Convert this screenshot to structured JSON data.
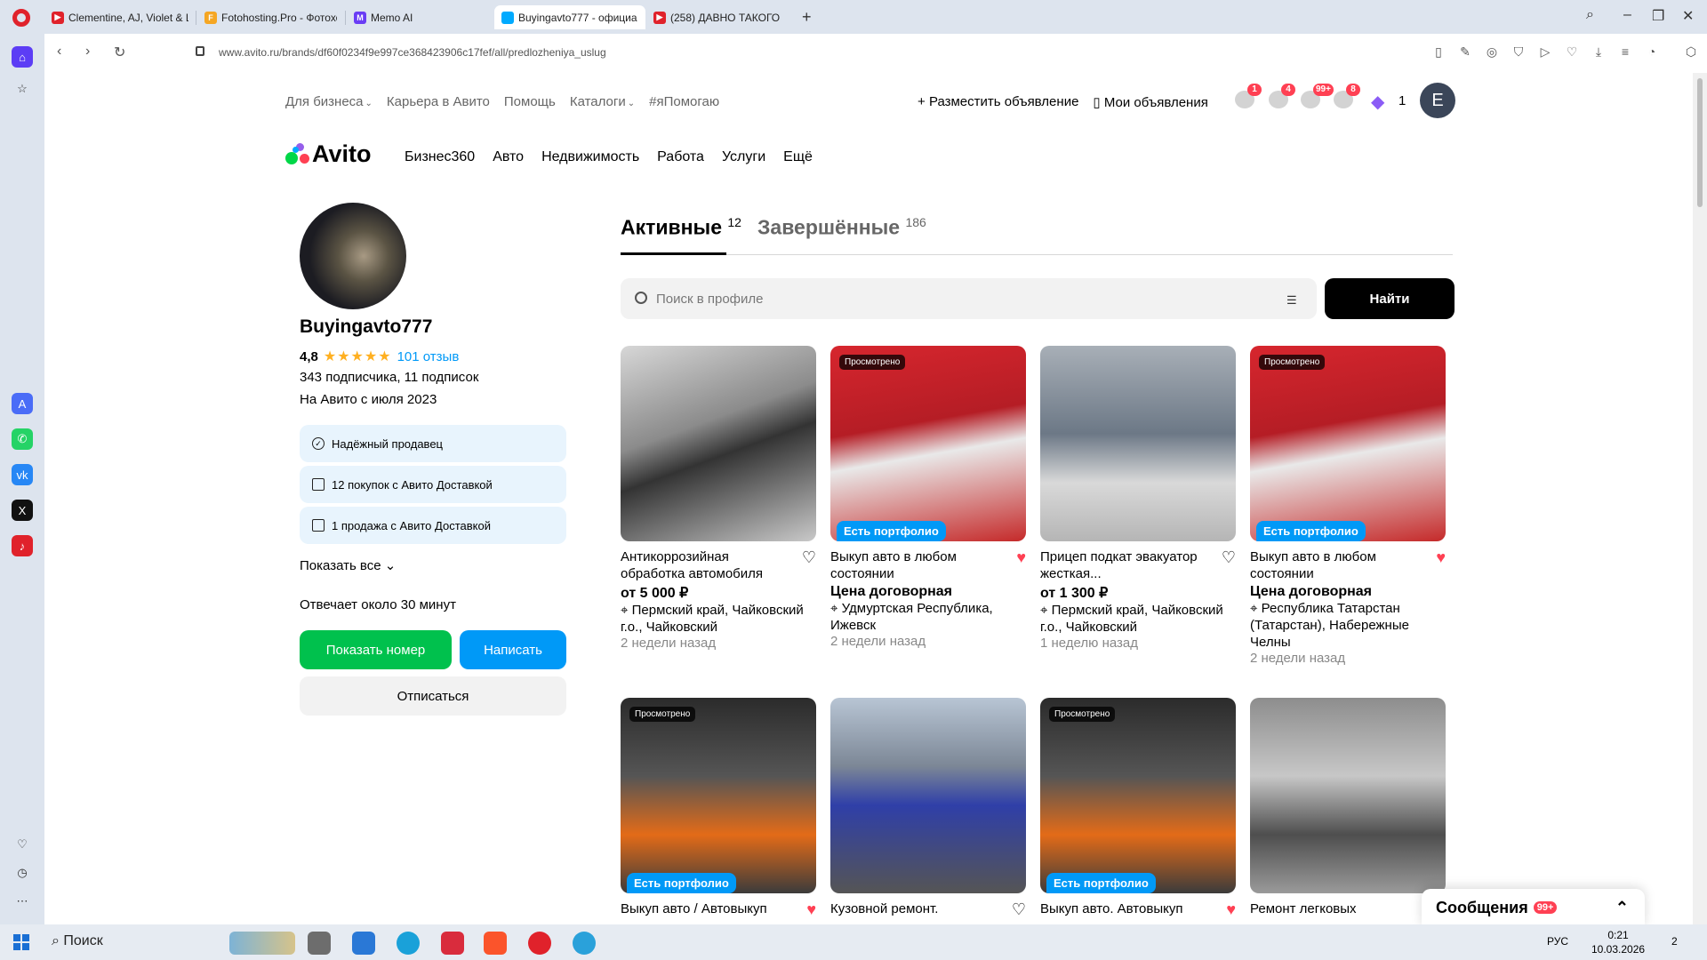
{
  "browser": {
    "tabs": [
      {
        "label": "Clementine, AJ, Violet & L",
        "color": "#e0222b"
      },
      {
        "label": "Fotohosting.Pro - Фотохо",
        "color": "#f5a623"
      },
      {
        "label": "Memo AI",
        "color": "#6a3df5"
      },
      {
        "label": "Buyingavto777 - официа",
        "color": "#00aaff"
      },
      {
        "label": "(258) ДАВНО ТАКОГО",
        "color": "#e0222b"
      }
    ],
    "url": "www.avito.ru/brands/df60f0234f9e997ce368423906c17fef/all/predlozheniya_uslug"
  },
  "header": {
    "topnav": [
      "Для бизнеса",
      "Карьера в Авито",
      "Помощь",
      "Каталоги",
      "#яПомогаю"
    ],
    "post_ad": "Разместить объявление",
    "my_ads": "Мои объявления",
    "badges": {
      "favorites": "1",
      "notifications": "4",
      "messages": "99+",
      "cart": "8"
    },
    "coins": "1",
    "user_initial": "E",
    "logo": "Avito",
    "mainnav": [
      "Бизнес360",
      "Авто",
      "Недвижимость",
      "Работа",
      "Услуги",
      "Ещё"
    ]
  },
  "profile": {
    "name": "Buyingavto777",
    "rating": "4,8",
    "reviews": "101 отзыв",
    "followers": "343 подписчика, 11 подписок",
    "since": "На Авито с июля 2023",
    "features": [
      "Надёжный продавец",
      "12 покупок с Авито Доставкой",
      "1 продажа с Авито Доставкой"
    ],
    "show_all": "Показать все",
    "response": "Отвечает около 30 минут",
    "show_phone": "Показать номер",
    "write": "Написать",
    "unsubscribe": "Отписаться"
  },
  "listing": {
    "tab_active": "Активные",
    "tab_active_count": "12",
    "tab_done": "Завершённые",
    "tab_done_count": "186",
    "search_placeholder": "Поиск в профиле",
    "find_btn": "Найти",
    "seen_label": "Просмотрено",
    "portfolio_label": "Есть портфолио",
    "cards": [
      {
        "title": "Антикоррозийная обработка автомобиля",
        "price": "от 5 000 ₽",
        "location": "Пермский край, Чайковский г.о., Чайковский",
        "date": "2 недели назад",
        "liked": false
      },
      {
        "title": "Выкуп авто в любом состоянии",
        "price": "Цена договорная",
        "location": "Удмуртская Республика, Ижевск",
        "date": "2 недели назад",
        "liked": true
      },
      {
        "title": "Прицеп подкат эвакуатор жесткая...",
        "price": "от 1 300 ₽",
        "location": "Пермский край, Чайковский г.о., Чайковский",
        "date": "1 неделю назад",
        "liked": false
      },
      {
        "title": "Выкуп авто в любом состоянии",
        "price": "Цена договорная",
        "location": "Республика Татарстан (Татарстан), Набережные Челны",
        "date": "2 недели назад",
        "liked": true
      },
      {
        "title": "Выкуп авто / Автовыкуп",
        "liked": true
      },
      {
        "title": "Кузовной ремонт.",
        "liked": false
      },
      {
        "title": "Выкуп авто. Автовыкуп",
        "liked": true
      },
      {
        "title": "Ремонт легковых",
        "liked": false
      }
    ]
  },
  "messages_widget": {
    "label": "Сообщения",
    "badge": "99+"
  },
  "taskbar": {
    "search": "Поиск",
    "lang": "РУС",
    "time": "0:21",
    "date": "10.03.2026",
    "notif": "2"
  }
}
